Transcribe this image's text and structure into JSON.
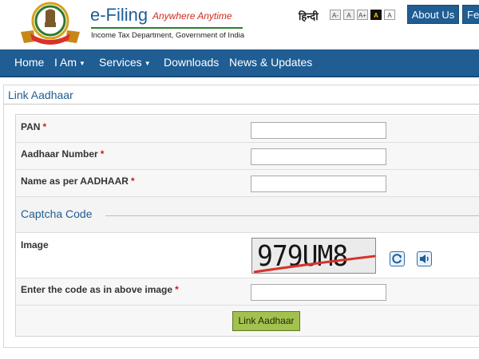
{
  "header": {
    "title": "e-Filing",
    "tagline": "Anywhere Anytime",
    "subtitle": "Income Tax Department, Government of India",
    "language_link": "हिन्दी",
    "font_controls": [
      "A-",
      "A",
      "A+",
      "A",
      "A"
    ],
    "about_label": "About Us",
    "feedback_label": "Fe"
  },
  "nav": {
    "items": [
      {
        "label": "Home"
      },
      {
        "label": "I Am"
      },
      {
        "label": "Services"
      },
      {
        "label": "Downloads"
      },
      {
        "label": "News & Updates"
      }
    ]
  },
  "page": {
    "title": "Link Aadhaar"
  },
  "form": {
    "pan": {
      "label": "PAN",
      "required": "*",
      "value": ""
    },
    "aadhaar": {
      "label": "Aadhaar Number",
      "required": "*",
      "value": ""
    },
    "name": {
      "label": "Name as per AADHAAR",
      "required": "*",
      "value": ""
    },
    "captcha_section": "Captcha Code",
    "image_label": "Image",
    "captcha_text": "979UM8",
    "code": {
      "label": "Enter the code as in above image",
      "required": "*",
      "value": ""
    },
    "submit_label": "Link Aadhaar"
  },
  "icons": {
    "refresh": "refresh-icon",
    "audio": "audio-icon",
    "emblem": "emblem-logo"
  },
  "colors": {
    "brand_blue": "#1f5d93",
    "accent_red": "#d12a1e",
    "button_green": "#a3c14f"
  }
}
